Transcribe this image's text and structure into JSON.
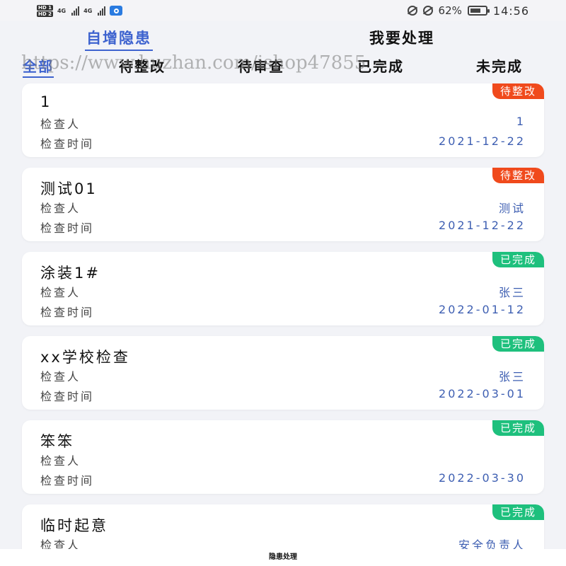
{
  "status_bar": {
    "sim1": "HD 1",
    "sim2": "HD 2",
    "net1": "4G",
    "net2": "4G",
    "battery": "62%",
    "time": "14:56"
  },
  "top_tabs": [
    {
      "label": "自增隐患",
      "active": true
    },
    {
      "label": "我要处理",
      "active": false
    }
  ],
  "sub_tabs": [
    {
      "label": "全部",
      "active": true
    },
    {
      "label": "待整改",
      "active": false
    },
    {
      "label": "待审查",
      "active": false
    },
    {
      "label": "已完成",
      "active": false
    },
    {
      "label": "未完成",
      "active": false
    }
  ],
  "watermark": "https://www.huzhan.com/ishop47855",
  "labels": {
    "inspector": "检查人",
    "inspect_time": "检查时间"
  },
  "items": [
    {
      "title": "1",
      "status": "待整改",
      "status_color": "#f04a1c",
      "inspector": "1",
      "date": "2021-12-22"
    },
    {
      "title": "测试01",
      "status": "待整改",
      "status_color": "#f04a1c",
      "inspector": "测试",
      "date": "2021-12-22"
    },
    {
      "title": "涂装1#",
      "status": "已完成",
      "status_color": "#1ec07d",
      "inspector": "张三",
      "date": "2022-01-12"
    },
    {
      "title": "xx学校检查",
      "status": "已完成",
      "status_color": "#1ec07d",
      "inspector": "张三",
      "date": "2022-03-01"
    },
    {
      "title": "笨笨",
      "status": "已完成",
      "status_color": "#1ec07d",
      "inspector": "",
      "date": "2022-03-30"
    },
    {
      "title": "临时起意",
      "status": "已完成",
      "status_color": "#1ec07d",
      "inspector": "安全负责人",
      "date": ""
    }
  ],
  "bottom_title": "隐患处理"
}
